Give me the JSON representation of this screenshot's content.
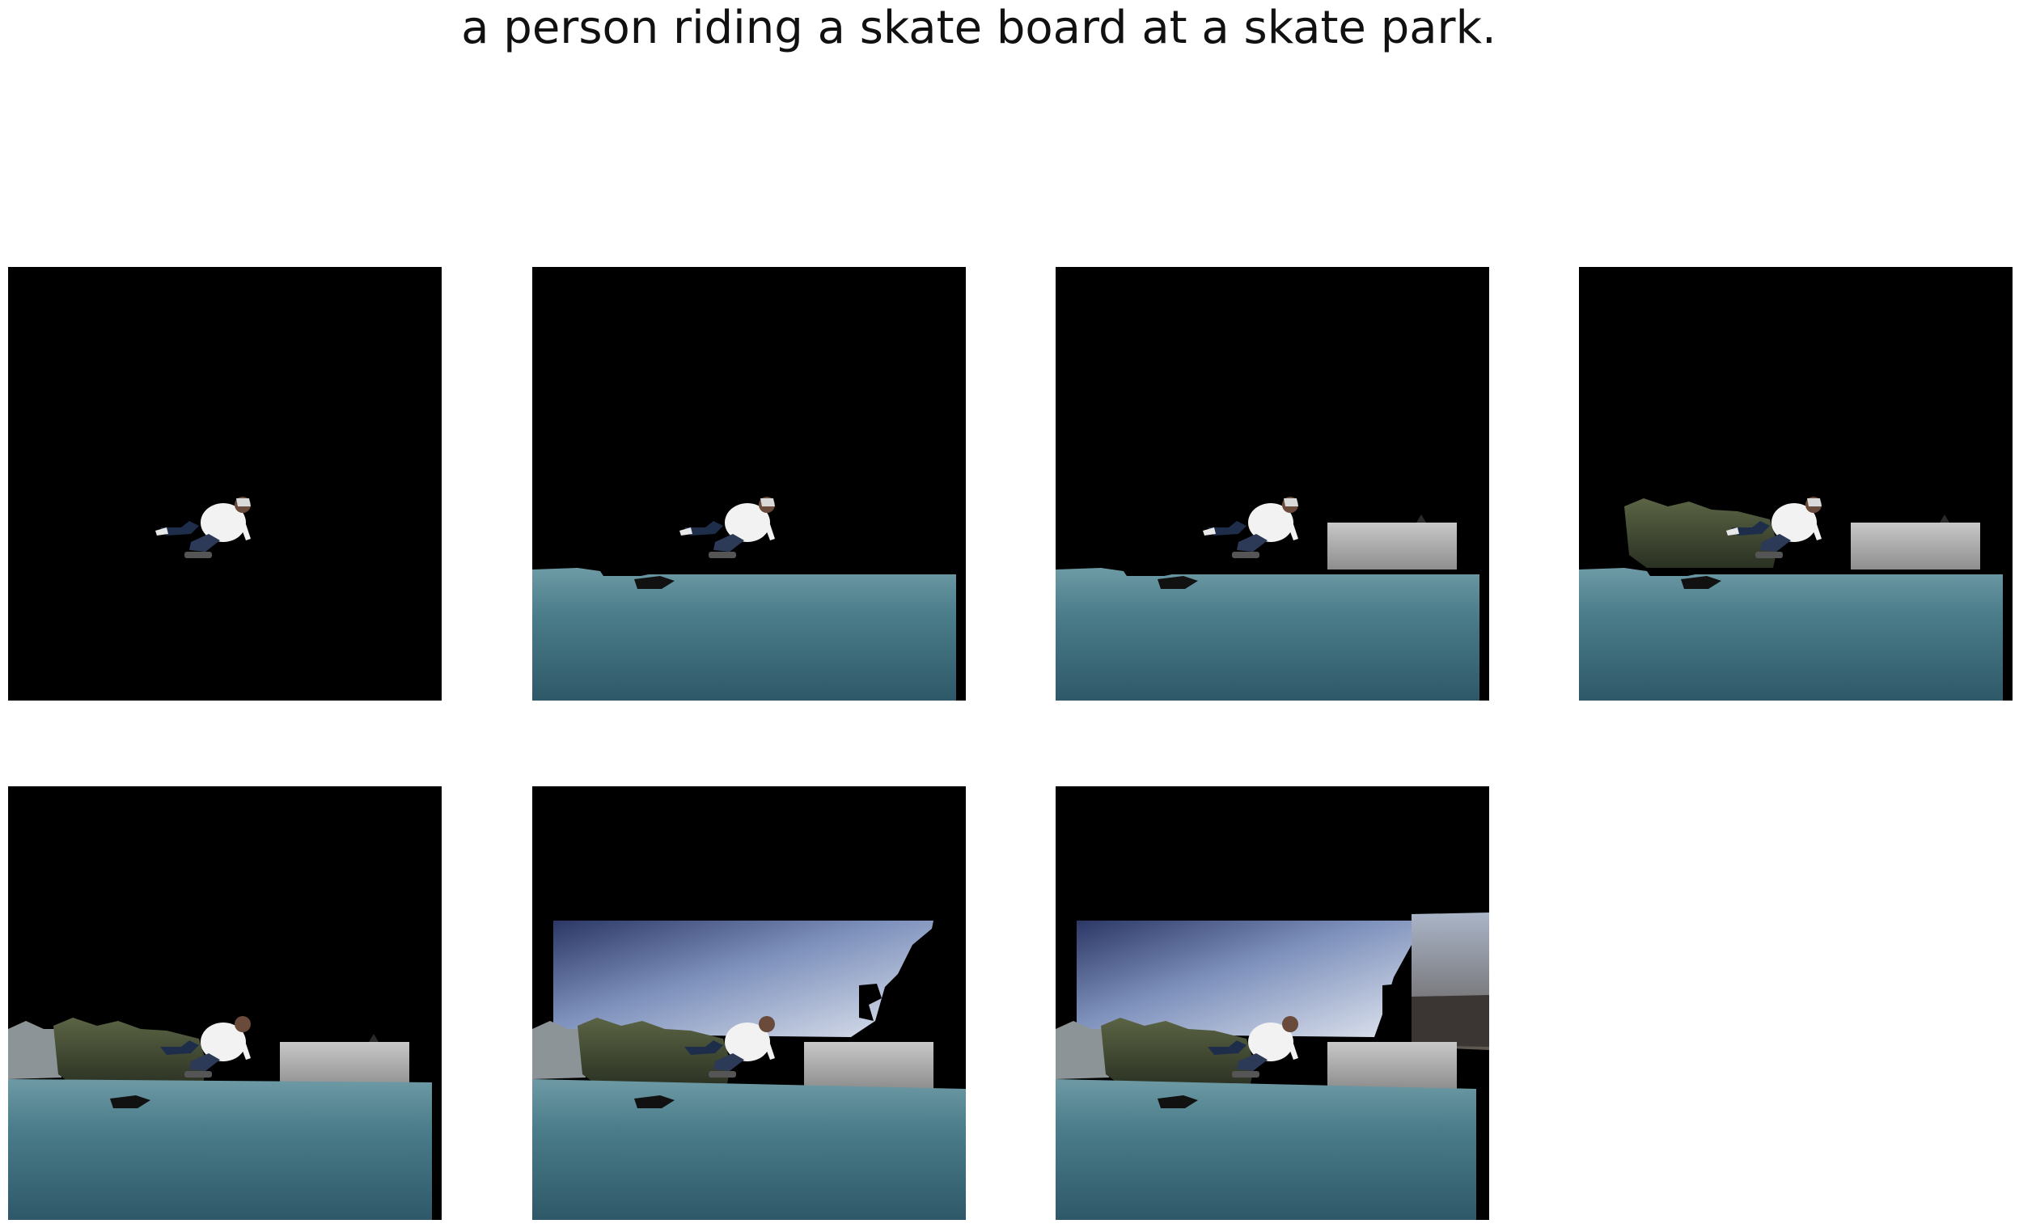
{
  "figure": {
    "caption": "a person riding a skate board at a skate park."
  },
  "panels": [
    {
      "id": "step-1",
      "layers": [
        "skateboarder"
      ]
    },
    {
      "id": "step-2",
      "layers": [
        "skateboarder",
        "ground"
      ]
    },
    {
      "id": "step-3",
      "layers": [
        "skateboarder",
        "ground",
        "wall"
      ]
    },
    {
      "id": "step-4",
      "layers": [
        "skateboarder",
        "ground",
        "wall",
        "trees"
      ]
    },
    {
      "id": "step-5",
      "layers": [
        "skateboarder",
        "ground",
        "wall",
        "trees",
        "left-tree"
      ]
    },
    {
      "id": "step-6",
      "layers": [
        "skateboarder",
        "ground",
        "wall",
        "trees",
        "left-tree",
        "sky"
      ]
    },
    {
      "id": "step-7",
      "layers": [
        "skateboarder",
        "ground",
        "wall",
        "trees",
        "left-tree",
        "sky",
        "building"
      ]
    }
  ],
  "colors": {
    "background": "#000000",
    "ground": "#3f6b78",
    "sky_top": "#3a4a78",
    "sky_bottom": "#c9d4e2",
    "wall": "#a9a9a9",
    "trees": "#3b4430",
    "shirt": "#f2f2f2"
  }
}
